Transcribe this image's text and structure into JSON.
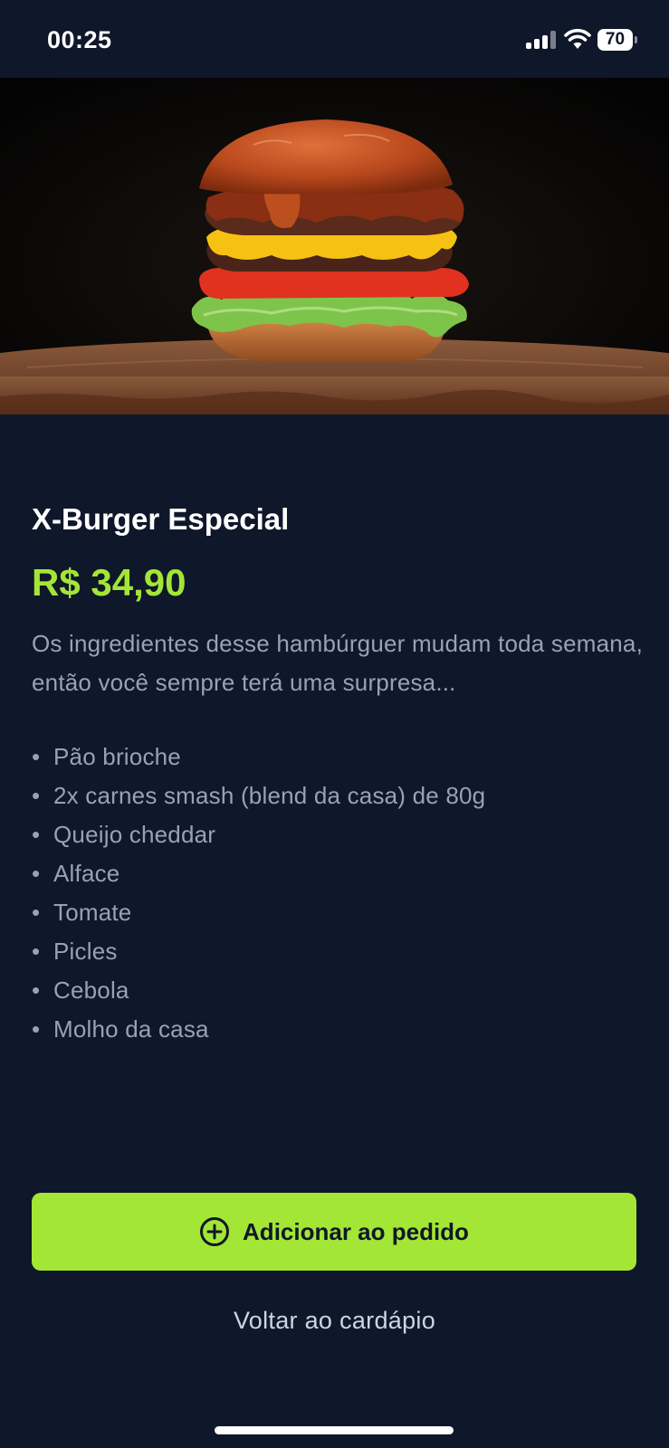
{
  "status_bar": {
    "time": "00:25",
    "battery": "70",
    "icons": [
      "cellular-signal-icon",
      "wifi-icon",
      "battery-icon"
    ]
  },
  "hero": {
    "image": "burger-photo"
  },
  "product": {
    "title": "X-Burger Especial",
    "price": "R$ 34,90",
    "description": "Os ingredientes desse hambúrguer mudam toda semana, então você sempre terá uma surpresa...",
    "ingredients": [
      "Pão brioche",
      "2x carnes smash (blend da casa) de 80g",
      "Queijo cheddar",
      "Alface",
      "Tomate",
      "Picles",
      "Cebola",
      "Molho da casa"
    ]
  },
  "actions": {
    "add_label": "Adicionar ao pedido",
    "add_icon": "plus-circle-icon",
    "back_label": "Voltar ao cardápio"
  },
  "colors": {
    "background": "#0f172a",
    "accent": "#a3e635",
    "muted_text": "#94a3b8",
    "title_text": "#ffffff"
  }
}
